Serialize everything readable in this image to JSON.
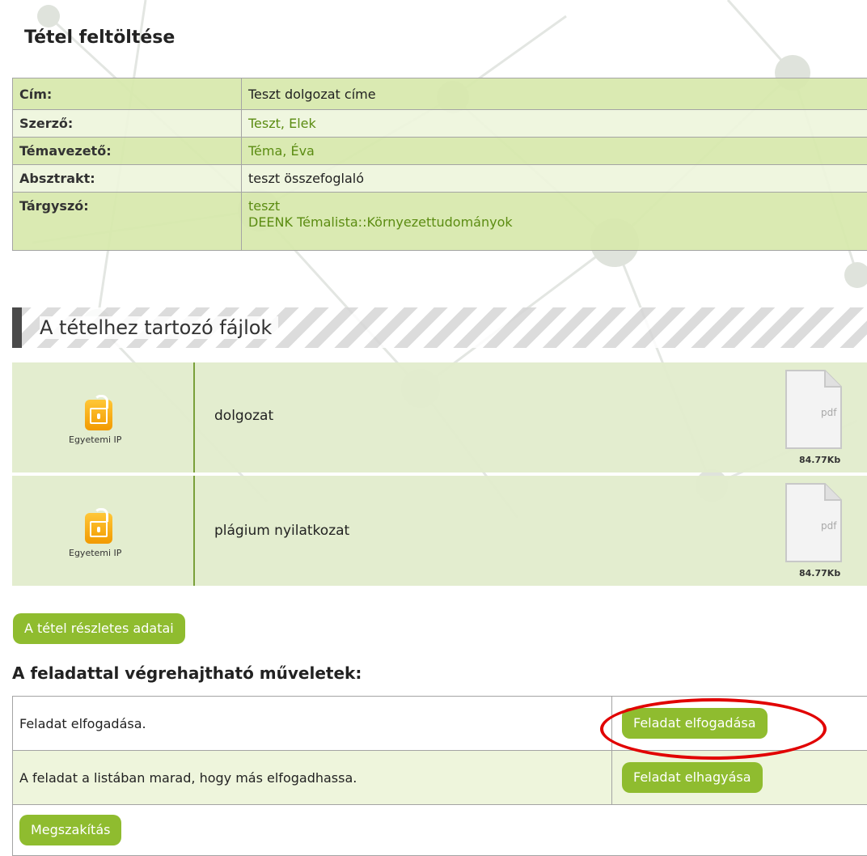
{
  "page": {
    "title": "Tétel feltöltése"
  },
  "metadata": [
    {
      "label": "Cím:",
      "value": "Teszt dolgozat címe"
    },
    {
      "label": "Szerző:",
      "value": "Teszt, Elek"
    },
    {
      "label": "Témavezető:",
      "value": "Téma, Éva"
    },
    {
      "label": "Absztrakt:",
      "value": "teszt összefoglaló"
    },
    {
      "label": "Tárgyszó:",
      "values": [
        "teszt",
        "DEENK Témalista::Környezettudományok"
      ]
    }
  ],
  "files_section": {
    "title": "A tételhez tartozó fájlok"
  },
  "files": [
    {
      "access": "Egyetemi IP",
      "name": "dolgozat",
      "type": "pdf",
      "size": "84.77Kb",
      "icon": "lock-icon"
    },
    {
      "access": "Egyetemi IP",
      "name": "plágium nyilatkozat",
      "type": "pdf",
      "size": "84.77Kb",
      "icon": "lock-icon"
    }
  ],
  "details_button": "A tétel részletes adatai",
  "operations": {
    "title": "A feladattal végrehajtható műveletek:",
    "rows": [
      {
        "description": "Feladat elfogadása.",
        "button": "Feladat elfogadása"
      },
      {
        "description": "A feladat a listában marad, hogy más elfogadhassa.",
        "button": "Feladat elhagyása"
      }
    ],
    "cancel_button": "Megszakítás"
  },
  "colors": {
    "accent_green": "#8fbc2f",
    "row_green": "#d7e8ac",
    "row_light": "#eef5dc",
    "lock_orange": "#f7a800",
    "highlight_red": "#e10000"
  }
}
